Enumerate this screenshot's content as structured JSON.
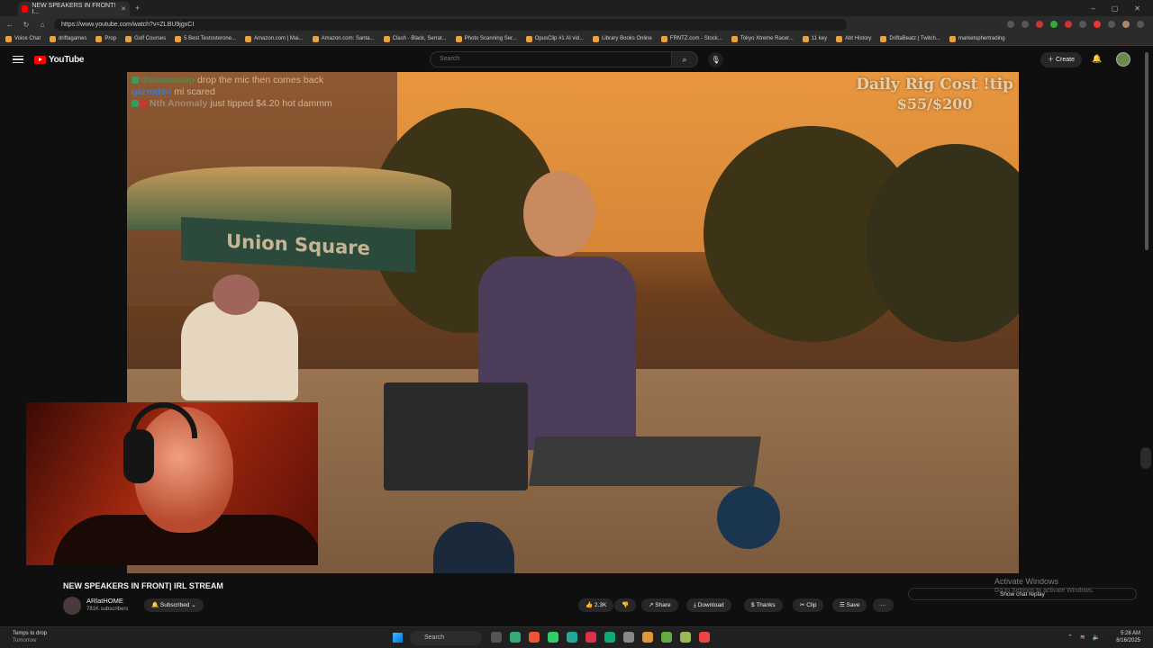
{
  "browser": {
    "tab_title": "NEW SPEAKERS IN FRONT! I...",
    "url": "https://www.youtube.com/watch?v=ZLBU9jgxCI",
    "window_controls": [
      "–",
      "▢",
      "✕"
    ],
    "bookmarks": [
      "Voice Chat",
      "driftagames",
      "Prop",
      "Golf Courses",
      "5 Best Testosterone...",
      "Amazon.com | Mai...",
      "Amazon.com: Santa...",
      "Clash - Black, Serrat...",
      "Photo Scanning Ser...",
      "OpusClip #1 AI vid...",
      "Library Books Online",
      "FRNTZ.com - Stock...",
      "Tokyo Xtreme Racer...",
      "11 key",
      "Abt History",
      "DriftaBeatz | Twitch...",
      "marketsphertrading"
    ]
  },
  "youtube": {
    "logo": "YouTube",
    "search_placeholder": "Search",
    "create_label": "Create"
  },
  "video": {
    "chat": [
      {
        "user": "datswassup",
        "text": "drop the mic then comes back"
      },
      {
        "user": "garmden",
        "text": "mi scared"
      },
      {
        "user": "Nth Anomaly",
        "text": "just tipped $4.20 hot dammm"
      }
    ],
    "overlay_title": "Daily Rig Cost !tip",
    "overlay_amount": "$55/$200",
    "sign_text": "Union Square"
  },
  "below": {
    "title": "NEW SPEAKERS IN FRONT| IRL STREAM",
    "channel": "ARlatHOME",
    "subs": "781K subscribers",
    "subscribed": "Subscribed",
    "likes": "2.3K",
    "share": "Share",
    "download": "Download",
    "thanks": "Thanks",
    "clip": "Clip",
    "save": "Save",
    "more": "···",
    "show_chat": "Show chat replay",
    "activate1": "Activate Windows",
    "activate2": "Go to Settings to activate Windows."
  },
  "taskbar": {
    "weather_line1": "Temps to drop",
    "weather_line2": "Tomorrow",
    "search": "Search",
    "time": "5:28 AM",
    "date": "8/16/2025"
  },
  "colors": {
    "yt_red": "#ff0000",
    "bg": "#0f0f0f"
  }
}
